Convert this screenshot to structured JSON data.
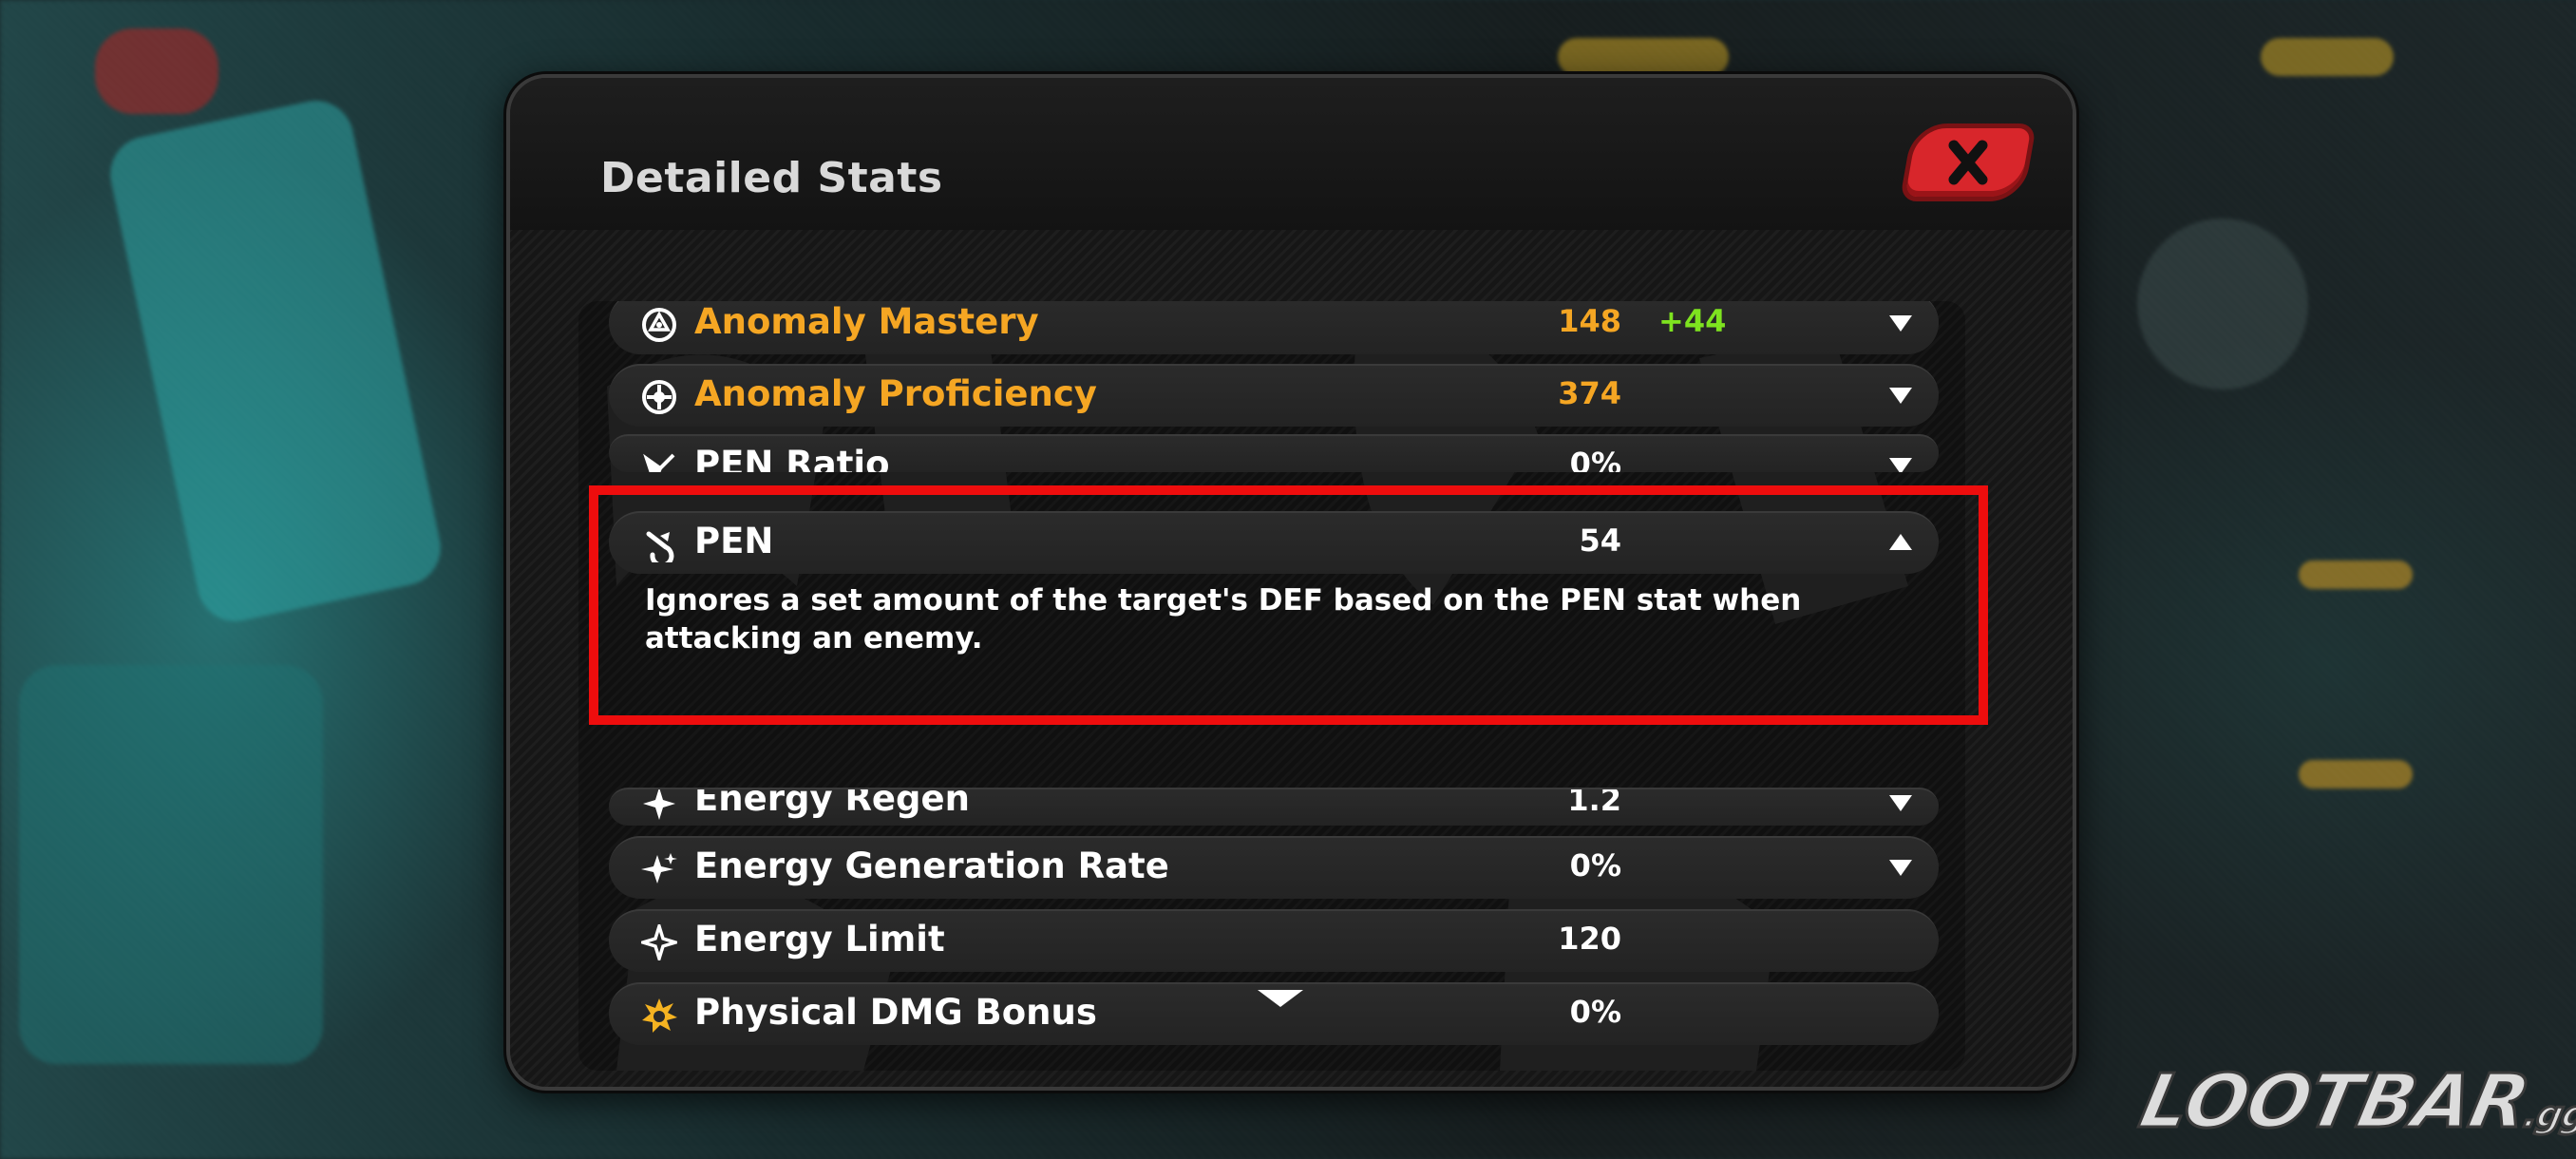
{
  "modal": {
    "title": "Detailed Stats",
    "close_icon": "close-x-icon",
    "close_color": "#d8262b"
  },
  "stats": [
    {
      "name": "Anomaly Mastery",
      "icon": "anomaly-mastery-icon",
      "base": "148",
      "bonus": "+44",
      "highlight": true,
      "expanded": false
    },
    {
      "name": "Anomaly Proficiency",
      "icon": "anomaly-proficiency-icon",
      "base": "374",
      "bonus": "",
      "highlight": true,
      "expanded": false
    },
    {
      "name": "PEN Ratio",
      "icon": "pen-ratio-icon",
      "base": "0%",
      "bonus": "",
      "highlight": false,
      "expanded": false
    },
    {
      "name": "PEN",
      "icon": "pen-icon",
      "base": "54",
      "bonus": "",
      "highlight": false,
      "expanded": true,
      "description": "Ignores a set amount of the target's DEF based on the PEN stat when attacking an enemy."
    },
    {
      "name": "Energy Regen",
      "icon": "energy-regen-icon",
      "base": "1.2",
      "bonus": "",
      "highlight": false,
      "expanded": false
    },
    {
      "name": "Energy Generation Rate",
      "icon": "energy-generation-icon",
      "base": "0%",
      "bonus": "",
      "highlight": false,
      "expanded": false
    },
    {
      "name": "Energy Limit",
      "icon": "energy-limit-icon",
      "base": "120",
      "bonus": "",
      "highlight": false,
      "expanded": false
    },
    {
      "name": "Physical DMG Bonus",
      "icon": "physical-dmg-icon",
      "base": "0%",
      "bonus": "",
      "highlight": false,
      "expanded": false
    }
  ],
  "colors": {
    "accent_gold": "#f5a623",
    "bonus_green": "#7ee31f",
    "highlight_red": "#ee0d0d"
  },
  "watermark": {
    "brand": "LOOTBAR",
    "suffix": ".gg"
  }
}
